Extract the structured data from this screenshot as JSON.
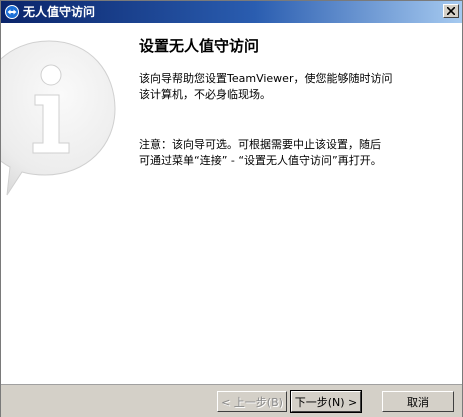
{
  "window": {
    "title": "无人值守访问",
    "close_icon": "close-icon"
  },
  "content": {
    "heading": "设置无人值守访问",
    "intro_line1": "该向导帮助您设置TeamViewer，使您能够随时访问",
    "intro_line2": "该计算机，不必身临现场。",
    "note_line1": "注意：该向导可选。可根据需要中止该设置，随后",
    "note_line2": "可通过菜单“连接” - “设置无人值守访问”再打开。",
    "art_icon": "info-bubble-icon"
  },
  "buttons": {
    "back": "< 上一步(B)",
    "next": "下一步(N) >",
    "cancel": "取消"
  },
  "colors": {
    "title_start": "#0a246a",
    "title_end": "#a6caf0",
    "face": "#d4d0c8"
  }
}
